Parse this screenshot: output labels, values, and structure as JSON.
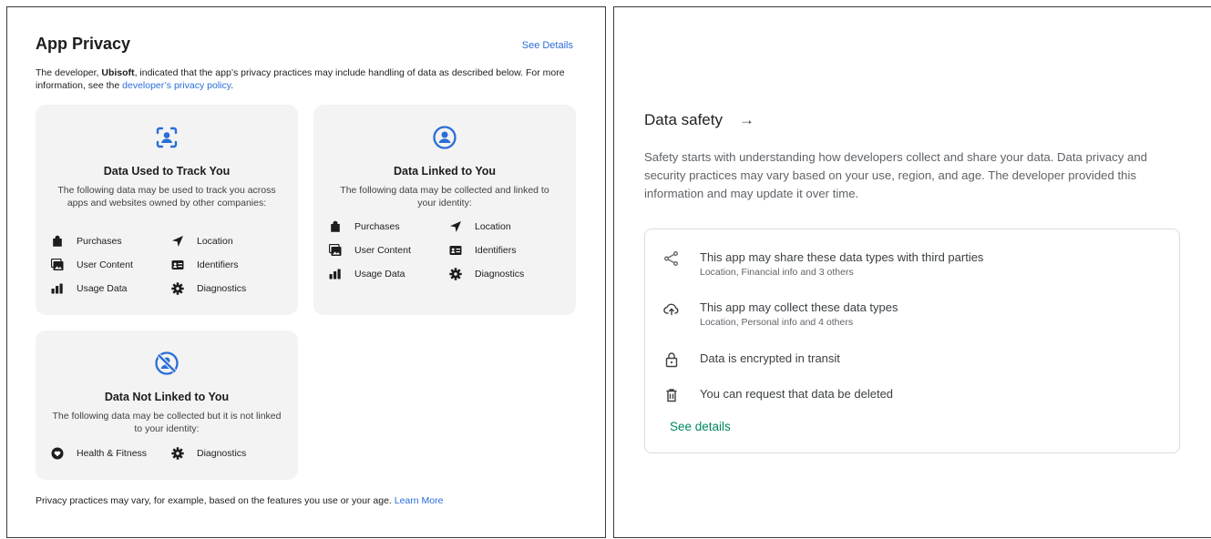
{
  "app_privacy": {
    "title": "App Privacy",
    "see_details": "See Details",
    "intro_prefix": "The developer, ",
    "developer": "Ubisoft",
    "intro_middle": ", indicated that the app’s privacy practices may include handling of data as described below. For more information, see the ",
    "policy_link": "developer’s privacy policy",
    "intro_suffix": ".",
    "cards": {
      "track": {
        "title": "Data Used to Track You",
        "description": "The following data may be used to track you across apps and websites owned by other companies:",
        "items": [
          "Purchases",
          "Location",
          "User Content",
          "Identifiers",
          "Usage Data",
          "Diagnostics"
        ]
      },
      "linked": {
        "title": "Data Linked to You",
        "description": "The following data may be collected and linked to your identity:",
        "items": [
          "Purchases",
          "Location",
          "User Content",
          "Identifiers",
          "Usage Data",
          "Diagnostics"
        ]
      },
      "not_linked": {
        "title": "Data Not Linked to You",
        "description": "The following data may be collected but it is not linked to your identity:",
        "items": [
          "Health & Fitness",
          "Diagnostics"
        ]
      }
    },
    "footer_text": "Privacy practices may vary, for example, based on the features you use or your age. ",
    "footer_link": "Learn More"
  },
  "data_safety": {
    "title": "Data safety",
    "arrow": "→",
    "description": "Safety starts with understanding how developers collect and share your data. Data privacy and security practices may vary based on your use, region, and age. The developer provided this information and may update it over time.",
    "rows": [
      {
        "icon": "share-icon",
        "main": "This app may share these data types with third parties",
        "sub": "Location, Financial info and 3 others"
      },
      {
        "icon": "cloud-upload-icon",
        "main": "This app may collect these data types",
        "sub": "Location, Personal info and 4 others"
      },
      {
        "icon": "lock-icon",
        "main": "Data is encrypted in transit",
        "sub": ""
      },
      {
        "icon": "trash-icon",
        "main": "You can request that data be deleted",
        "sub": ""
      }
    ],
    "see_details": "See details"
  },
  "colors": {
    "apple_link": "#2a6ed8",
    "card_bg": "#f3f3f3",
    "play_green": "#01875f"
  }
}
